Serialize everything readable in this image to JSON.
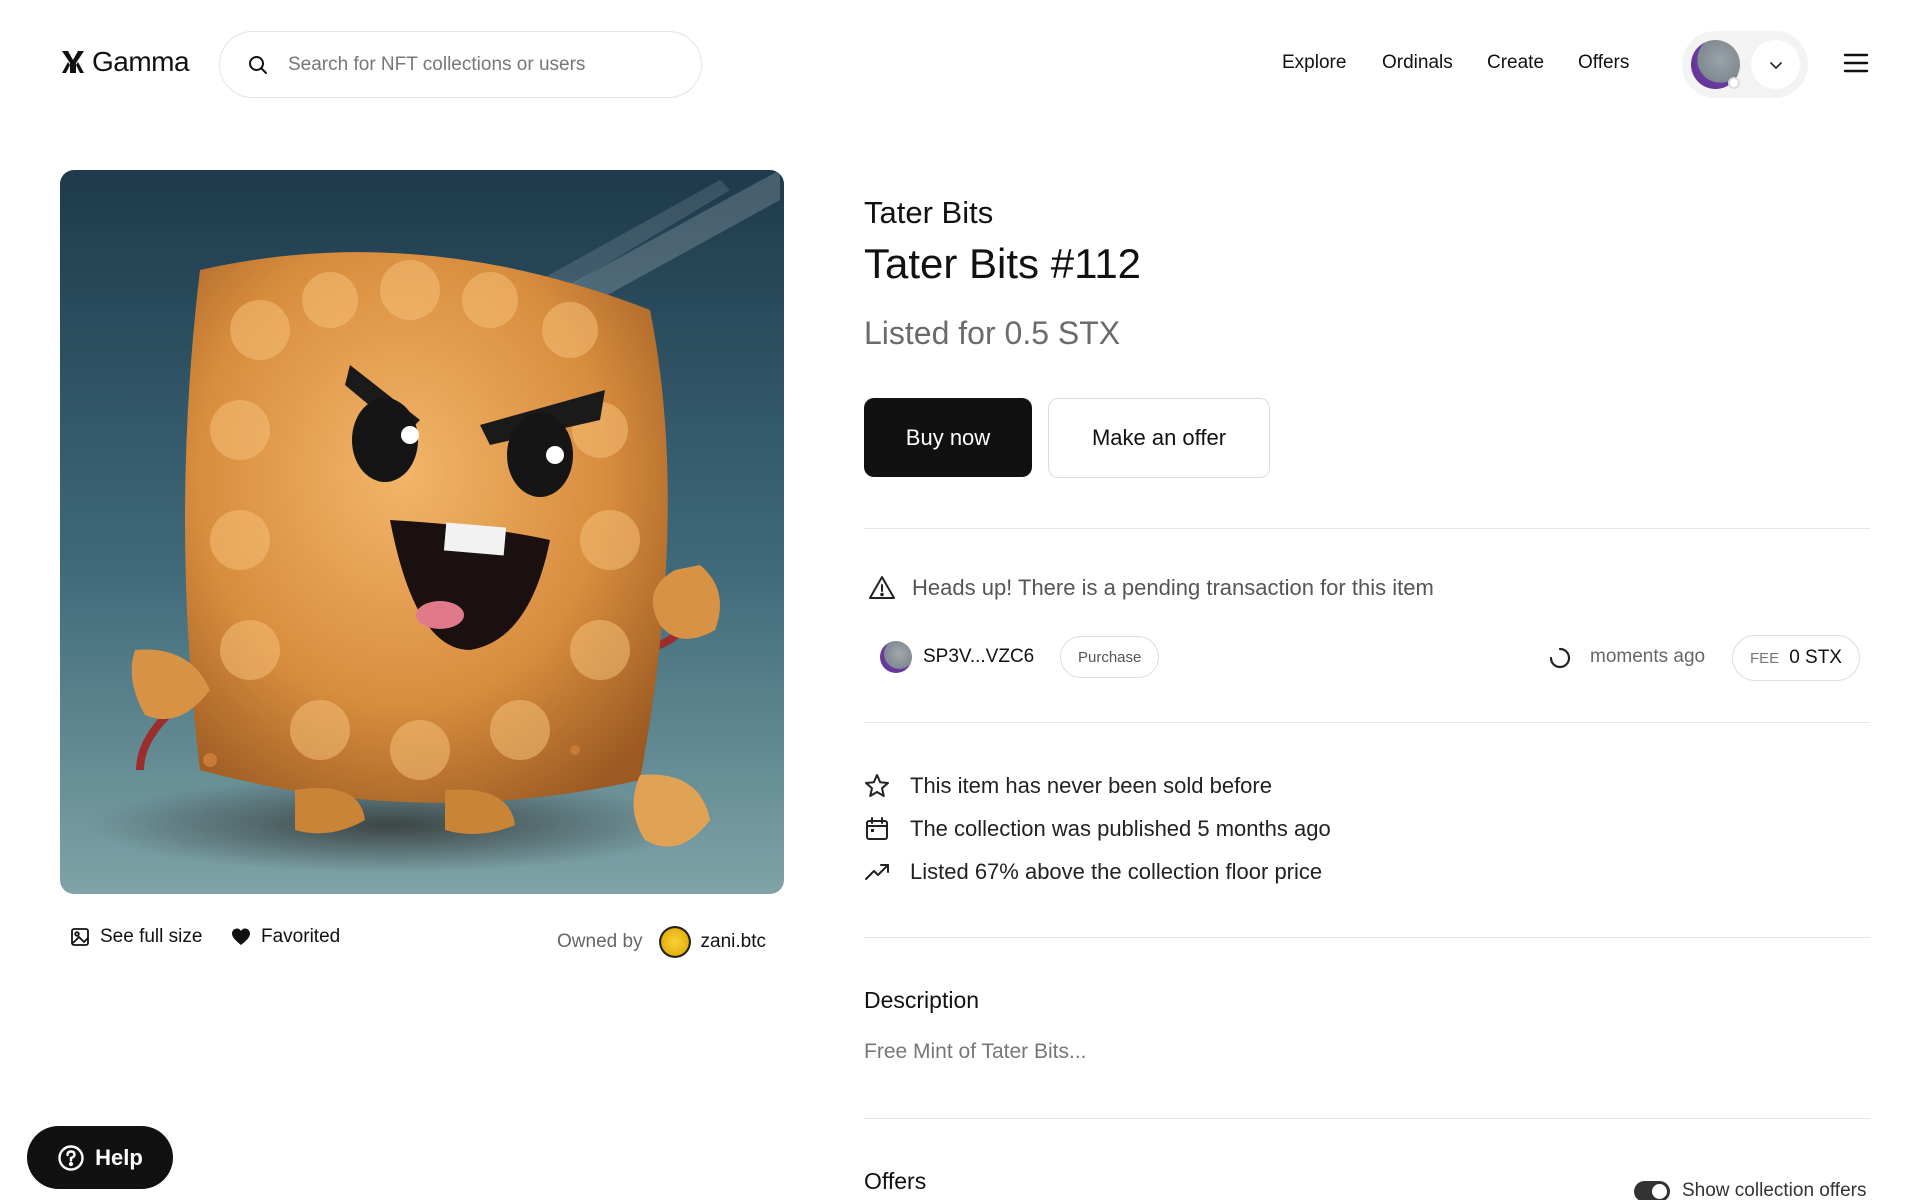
{
  "header": {
    "logo_text": "Gamma",
    "search_placeholder": "Search for NFT collections or users",
    "nav": [
      "Explore",
      "Ordinals",
      "Create",
      "Offers"
    ]
  },
  "artwork": {
    "alt": "Tater Bits #112",
    "see_full_size": "See full size",
    "favorited": "Favorited",
    "owned_by_label": "Owned by",
    "owner": "zani.btc"
  },
  "item": {
    "collection": "Tater Bits",
    "title": "Tater Bits #112",
    "listed": "Listed for 0.5 STX",
    "buy_label": "Buy now",
    "offer_label": "Make an offer"
  },
  "pending": {
    "message": "Heads up! There is a pending transaction for this item",
    "address": "SP3V...VZC6",
    "type": "Purchase",
    "time": "moments ago",
    "fee_label": "FEE",
    "fee_value": "0 STX"
  },
  "facts": [
    {
      "icon": "star-icon",
      "text": "This item has never been sold before"
    },
    {
      "icon": "calendar-icon",
      "text": "The collection was published 5 months ago"
    },
    {
      "icon": "trending-up-icon",
      "text": "Listed 67% above the collection floor price"
    }
  ],
  "description": {
    "title": "Description",
    "text": "Free Mint of Tater Bits..."
  },
  "offers": {
    "title": "Offers",
    "toggle_label": "Show collection offers",
    "toggle_on": true
  },
  "help_label": "Help"
}
